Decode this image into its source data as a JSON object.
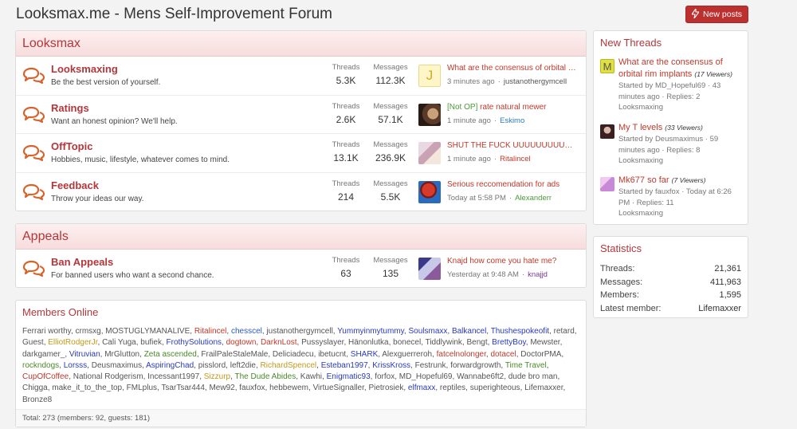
{
  "title": "Looksmax.me - Mens Self-Improvement Forum",
  "new_posts_label": "New posts",
  "sections": [
    {
      "title": "Looksmax",
      "nodes": [
        {
          "title": "Looksmaxing",
          "desc": "Be the best version of yourself.",
          "threads_label": "Threads",
          "threads": "5.3K",
          "messages_label": "Messages",
          "messages": "112.3K",
          "last_title": "What are the consensus of orbital …",
          "last_time": "3 minutes ago",
          "sep": "·",
          "last_user": "justanothergymcell",
          "user_color": "#555555"
        },
        {
          "title": "Ratings",
          "desc": "Want an honest opinion? We'll help.",
          "threads_label": "Threads",
          "threads": "2.6K",
          "messages_label": "Messages",
          "messages": "57.1K",
          "last_title_prefix": "[Not OP]",
          "last_title": "rate natural mewer",
          "last_time": "1 minute ago",
          "sep": "·",
          "last_user": "Eskimo",
          "user_color": "#2a7bbf"
        },
        {
          "title": "OffTopic",
          "desc": "Hobbies, music, lifestyle, whatever comes to mind.",
          "threads_label": "Threads",
          "threads": "13.1K",
          "messages_label": "Messages",
          "messages": "236.9K",
          "last_title": "SHUT THE FUCK UUUUUUUUU…",
          "last_time": "1 minute ago",
          "sep": "·",
          "last_user": "Ritalincel",
          "user_color": "#c0392b"
        },
        {
          "title": "Feedback",
          "desc": "Throw your ideas our way.",
          "threads_label": "Threads",
          "threads": "214",
          "messages_label": "Messages",
          "messages": "5.5K",
          "last_title": "Serious reccomendation for ads",
          "last_time": "Today at 5:58 PM",
          "sep": "·",
          "last_user": "Alexanderr",
          "user_color": "#4a9a3a"
        }
      ]
    },
    {
      "title": "Appeals",
      "nodes": [
        {
          "title": "Ban Appeals",
          "desc": "For banned users who want a second chance.",
          "threads_label": "Threads",
          "threads": "63",
          "messages_label": "Messages",
          "messages": "135",
          "last_title": "Knajd how come you hate me?",
          "last_time": "Yesterday at 9:48 AM",
          "sep": "·",
          "last_user": "knajjd",
          "user_color": "#7a3aa0"
        }
      ]
    }
  ],
  "members_online": {
    "title": "Members Online",
    "members": [
      {
        "n": "Ferrari worthy",
        "c": "#555555"
      },
      {
        "n": "crmsxg",
        "c": "#555555"
      },
      {
        "n": "MOSTUGLYMANALIVE",
        "c": "#555555"
      },
      {
        "n": "Ritalincel",
        "c": "#c0392b"
      },
      {
        "n": "chesscel",
        "c": "#2a5bbf"
      },
      {
        "n": "justanothergymcell",
        "c": "#555555"
      },
      {
        "n": "Yummyinmytummy",
        "c": "#2a3abf"
      },
      {
        "n": "Soulsmaxx",
        "c": "#2a3abf"
      },
      {
        "n": "Balkancel",
        "c": "#2a3abf"
      },
      {
        "n": "Thushespokeofit",
        "c": "#2a3abf"
      },
      {
        "n": "retard",
        "c": "#555555"
      },
      {
        "n": "Guest",
        "c": "#555555"
      },
      {
        "n": "ElliotRodgerJr",
        "c": "#c49a1a"
      },
      {
        "n": "Cali Yuga",
        "c": "#555555"
      },
      {
        "n": "bufiek",
        "c": "#555555"
      },
      {
        "n": "FrothySolutions",
        "c": "#2a3abf"
      },
      {
        "n": "dogtown",
        "c": "#c0392b"
      },
      {
        "n": "DarknLost",
        "c": "#c0392b"
      },
      {
        "n": "Pussyslayer",
        "c": "#555555"
      },
      {
        "n": "Hänonlutka",
        "c": "#555555"
      },
      {
        "n": "bonecel",
        "c": "#555555"
      },
      {
        "n": "Tiddlywink",
        "c": "#555555"
      },
      {
        "n": "Bengt",
        "c": "#555555"
      },
      {
        "n": "BrettyBoy",
        "c": "#2a3abf"
      },
      {
        "n": "Mewster",
        "c": "#555555"
      },
      {
        "n": "darkgamer_",
        "c": "#555555"
      },
      {
        "n": "Vitruvian",
        "c": "#2a3abf"
      },
      {
        "n": "MrGlutton",
        "c": "#555555"
      },
      {
        "n": "Zeta ascended",
        "c": "#4a8a2a"
      },
      {
        "n": "FrailPaleStaleMale",
        "c": "#555555"
      },
      {
        "n": "Deliciadecu",
        "c": "#555555"
      },
      {
        "n": "ibetucnt",
        "c": "#555555"
      },
      {
        "n": "SHARK",
        "c": "#2a3abf"
      },
      {
        "n": "Alexguerreroh",
        "c": "#555555"
      },
      {
        "n": "fatcelnolonger",
        "c": "#c0392b"
      },
      {
        "n": "dotacel",
        "c": "#c0392b"
      },
      {
        "n": "DoctorPMA",
        "c": "#555555"
      },
      {
        "n": "rockndogs",
        "c": "#4a8a2a"
      },
      {
        "n": "Lorsss",
        "c": "#2a3abf"
      },
      {
        "n": "Deusmaximus",
        "c": "#555555"
      },
      {
        "n": "AspiringChad",
        "c": "#2a3abf"
      },
      {
        "n": "pisslord",
        "c": "#555555"
      },
      {
        "n": "left2die",
        "c": "#555555"
      },
      {
        "n": "RichardSpencel",
        "c": "#c49a1a"
      },
      {
        "n": "Esteban1997",
        "c": "#2a3abf"
      },
      {
        "n": "KrissKross",
        "c": "#2a3abf"
      },
      {
        "n": "Festrunk",
        "c": "#555555"
      },
      {
        "n": "forwardgrowth",
        "c": "#555555"
      },
      {
        "n": "Time Travel",
        "c": "#4a8a2a"
      },
      {
        "n": "CupOfCoffee",
        "c": "#c0392b"
      },
      {
        "n": "National Rodgerism",
        "c": "#555555"
      },
      {
        "n": "Incessant1997",
        "c": "#555555"
      },
      {
        "n": "Sizzurp",
        "c": "#c49a1a"
      },
      {
        "n": "The Dude Abides",
        "c": "#4a8a2a"
      },
      {
        "n": "Kawhi",
        "c": "#555555"
      },
      {
        "n": "Enigmatic93",
        "c": "#2a3abf"
      },
      {
        "n": "forfox",
        "c": "#555555"
      },
      {
        "n": "MD_Hopeful69",
        "c": "#555555"
      },
      {
        "n": "Wannabe6ft2",
        "c": "#555555"
      },
      {
        "n": "dude bro man",
        "c": "#555555"
      },
      {
        "n": "Chigga",
        "c": "#555555"
      },
      {
        "n": "make_it_to_the_top",
        "c": "#555555"
      },
      {
        "n": "FMLplus",
        "c": "#555555"
      },
      {
        "n": "TsarTsar444",
        "c": "#555555"
      },
      {
        "n": "Mew92",
        "c": "#555555"
      },
      {
        "n": "fauxfox",
        "c": "#555555"
      },
      {
        "n": "hebbewem",
        "c": "#555555"
      },
      {
        "n": "VirtueSignaller",
        "c": "#555555"
      },
      {
        "n": "Pietrosiek",
        "c": "#555555"
      },
      {
        "n": "elfmaxx",
        "c": "#2a3abf"
      },
      {
        "n": "reptiles",
        "c": "#555555"
      },
      {
        "n": "superighteous",
        "c": "#555555"
      },
      {
        "n": "Lifemaxxer",
        "c": "#555555"
      },
      {
        "n": "Bronze8",
        "c": "#555555"
      }
    ],
    "footer": "Total: 273 (members: 92, guests: 181)"
  },
  "new_threads": {
    "title": "New Threads",
    "items": [
      {
        "title": "What are the consensus of orbital rim implants",
        "viewers": "(17 Viewers)",
        "meta1": "Started by MD_Hopeful69 · 43",
        "meta2": "minutes ago · Replies: 2",
        "forum": "Looksmaxing",
        "avatar": "M"
      },
      {
        "title": "My T levels",
        "viewers": "(33 Viewers)",
        "meta1": "Started by Deusmaximus · 59",
        "meta2": "minutes ago · Replies: 8",
        "forum": "Looksmaxing"
      },
      {
        "title": "Mk677 so far",
        "viewers": "(7 Viewers)",
        "meta1": "Started by fauxfox · Today at 6:26",
        "meta2": "PM · Replies: 11",
        "forum": "Looksmaxing"
      }
    ]
  },
  "statistics": {
    "title": "Statistics",
    "rows": [
      {
        "label": "Threads:",
        "value": "21,361"
      },
      {
        "label": "Messages:",
        "value": "411,963"
      },
      {
        "label": "Members:",
        "value": "1,595"
      },
      {
        "label": "Latest member:",
        "value": "Lifemaxxer"
      }
    ]
  },
  "avatar_letters": {
    "node0": "J"
  },
  "colors": {
    "accent": "#b4363a",
    "button": "#bd3030",
    "icon": "#d9622b"
  },
  "icons": {
    "node": "chat-bubbles-icon",
    "new_posts": "bolt-icon"
  }
}
